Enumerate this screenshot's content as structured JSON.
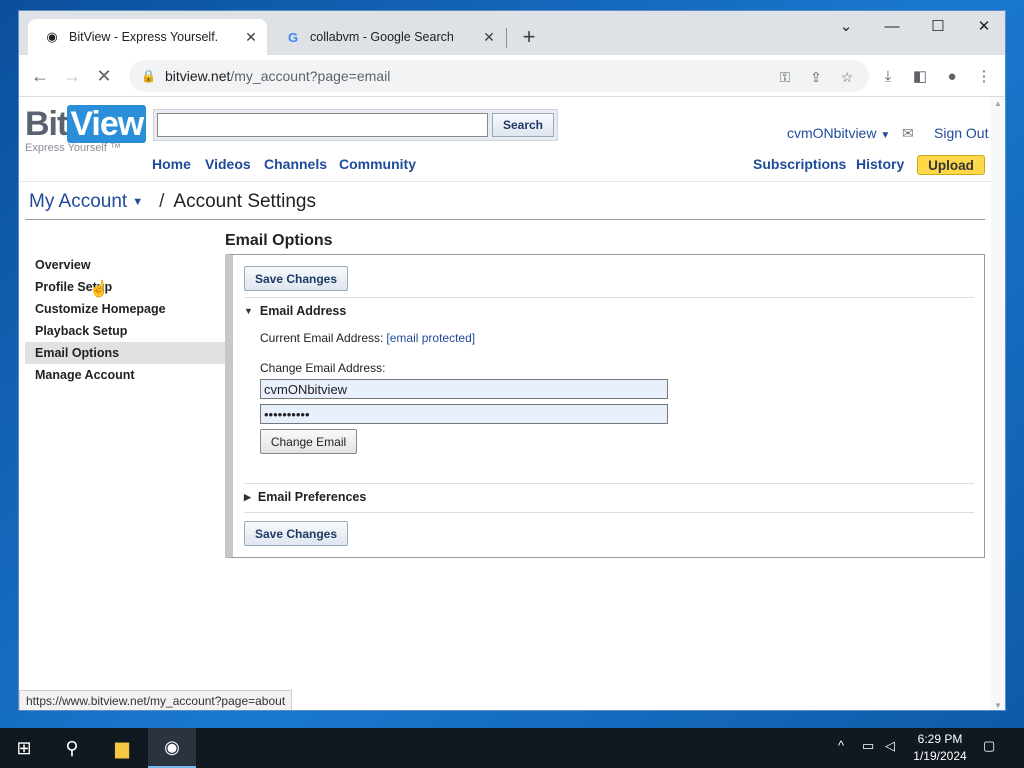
{
  "browser": {
    "tabs": [
      {
        "title": "BitView - Express Yourself.",
        "active": true
      },
      {
        "title": "collabvm - Google Search",
        "active": false
      }
    ],
    "url_host": "bitview.net",
    "url_path": "/my_account?page=email",
    "status_url": "https://www.bitview.net/my_account?page=about"
  },
  "site": {
    "logo_bit": "Bit",
    "logo_view": "View",
    "tagline": "Express Yourself ™",
    "search_button": "Search",
    "search_value": "",
    "nav": [
      "Home",
      "Videos",
      "Channels",
      "Community"
    ],
    "username": "cvmONbitview",
    "sign_out": "Sign Out",
    "subscriptions": "Subscriptions",
    "history": "History",
    "upload": "Upload"
  },
  "breadcrumb": {
    "my_account": "My Account",
    "separator": "/",
    "current": "Account Settings"
  },
  "page": {
    "section_title": "Email Options",
    "sidebar": [
      "Overview",
      "Profile Setup",
      "Customize Homepage",
      "Playback Setup",
      "Email Options",
      "Manage Account"
    ],
    "selected_sidebar": "Email Options",
    "save_changes": "Save Changes",
    "email_address_heading": "Email Address",
    "current_email_label": "Current Email Address:",
    "current_email_value": "[email protected]",
    "change_email_label": "Change Email Address:",
    "email_input_value": "cvmONbitview",
    "password_input_value": "••••••••••",
    "change_email_button": "Change Email",
    "email_preferences_heading": "Email Preferences"
  },
  "taskbar": {
    "time": "6:29 PM",
    "date": "1/19/2024"
  },
  "colors": {
    "link": "#1f4b9a",
    "upload": "#ffd84a",
    "desktop": "#1a78d0"
  }
}
